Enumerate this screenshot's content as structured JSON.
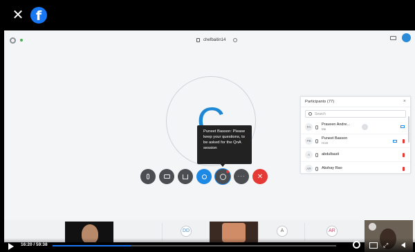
{
  "facebook": {
    "close_glyph": "✕",
    "logo_glyph": "f",
    "logo_color": "#1877f2"
  },
  "meeting": {
    "name": "chefbaitin14",
    "active_speaker_initial": "C",
    "accent": "#1f88d4"
  },
  "tooltip": {
    "text": "Puneet Basson: Please keep your questions, to be asked for the QnA session"
  },
  "controls": [
    {
      "name": "mute-button",
      "icon": "mic-icon"
    },
    {
      "name": "video-button",
      "icon": "camera-icon"
    },
    {
      "name": "share-button",
      "icon": "share-icon"
    },
    {
      "name": "participants-button",
      "icon": "person-icon"
    },
    {
      "name": "chat-button",
      "icon": "chat-icon"
    },
    {
      "name": "more-button",
      "icon": "more-icon",
      "label": "···"
    },
    {
      "name": "leave-button",
      "icon": "close-icon",
      "label": "✕"
    }
  ],
  "participants": {
    "title": "Participants (77)",
    "search_placeholder": "Search",
    "rows": [
      {
        "initials": "PA",
        "name": "Praveen Andre...",
        "sub": "Me"
      },
      {
        "initials": "PB",
        "name": "Puneet Basson",
        "sub": "Host"
      },
      {
        "initials": "A",
        "name": "abdulbasit",
        "sub": ""
      },
      {
        "initials": "AR",
        "name": "Akshay Rao",
        "sub": ""
      }
    ]
  },
  "filmstrip": {
    "avatars": [
      {
        "initials": "DD"
      },
      {
        "initials": "A"
      },
      {
        "initials": "AR"
      }
    ]
  },
  "player": {
    "time": "16:20 / 59:38",
    "progress": 0.275
  }
}
